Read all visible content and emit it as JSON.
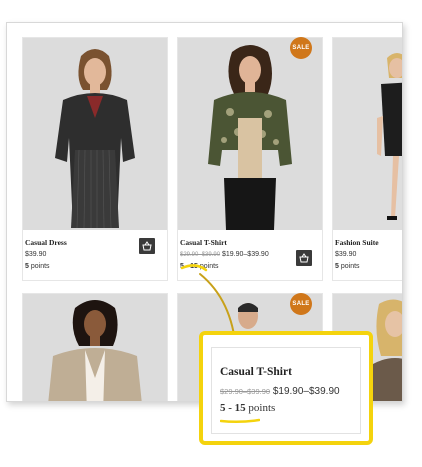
{
  "products": [
    {
      "name": "Casual Dress",
      "price": "$39.90",
      "points": "5",
      "points_suffix": "points"
    },
    {
      "name": "Casual T-Shirt",
      "old_price": "$29.90–$39.90",
      "price": "$19.90–$39.90",
      "points": "5 - 15",
      "points_suffix": "points",
      "badge": "SALE"
    },
    {
      "name": "Fashion Suite",
      "price": "$39.90",
      "points": "5",
      "points_suffix": "points"
    },
    {
      "badge": "SALE"
    }
  ],
  "callout": {
    "name": "Casual T-Shirt",
    "old_price": "$29.90–$39.90",
    "price": "$19.90–$39.90",
    "points": "5 - 15",
    "points_suffix": "points"
  },
  "colors": {
    "sale_badge": "#d0771a",
    "highlight": "#f4d30d",
    "cart_button": "#3a3a3a"
  },
  "icons": {
    "cart": "basket-icon"
  }
}
